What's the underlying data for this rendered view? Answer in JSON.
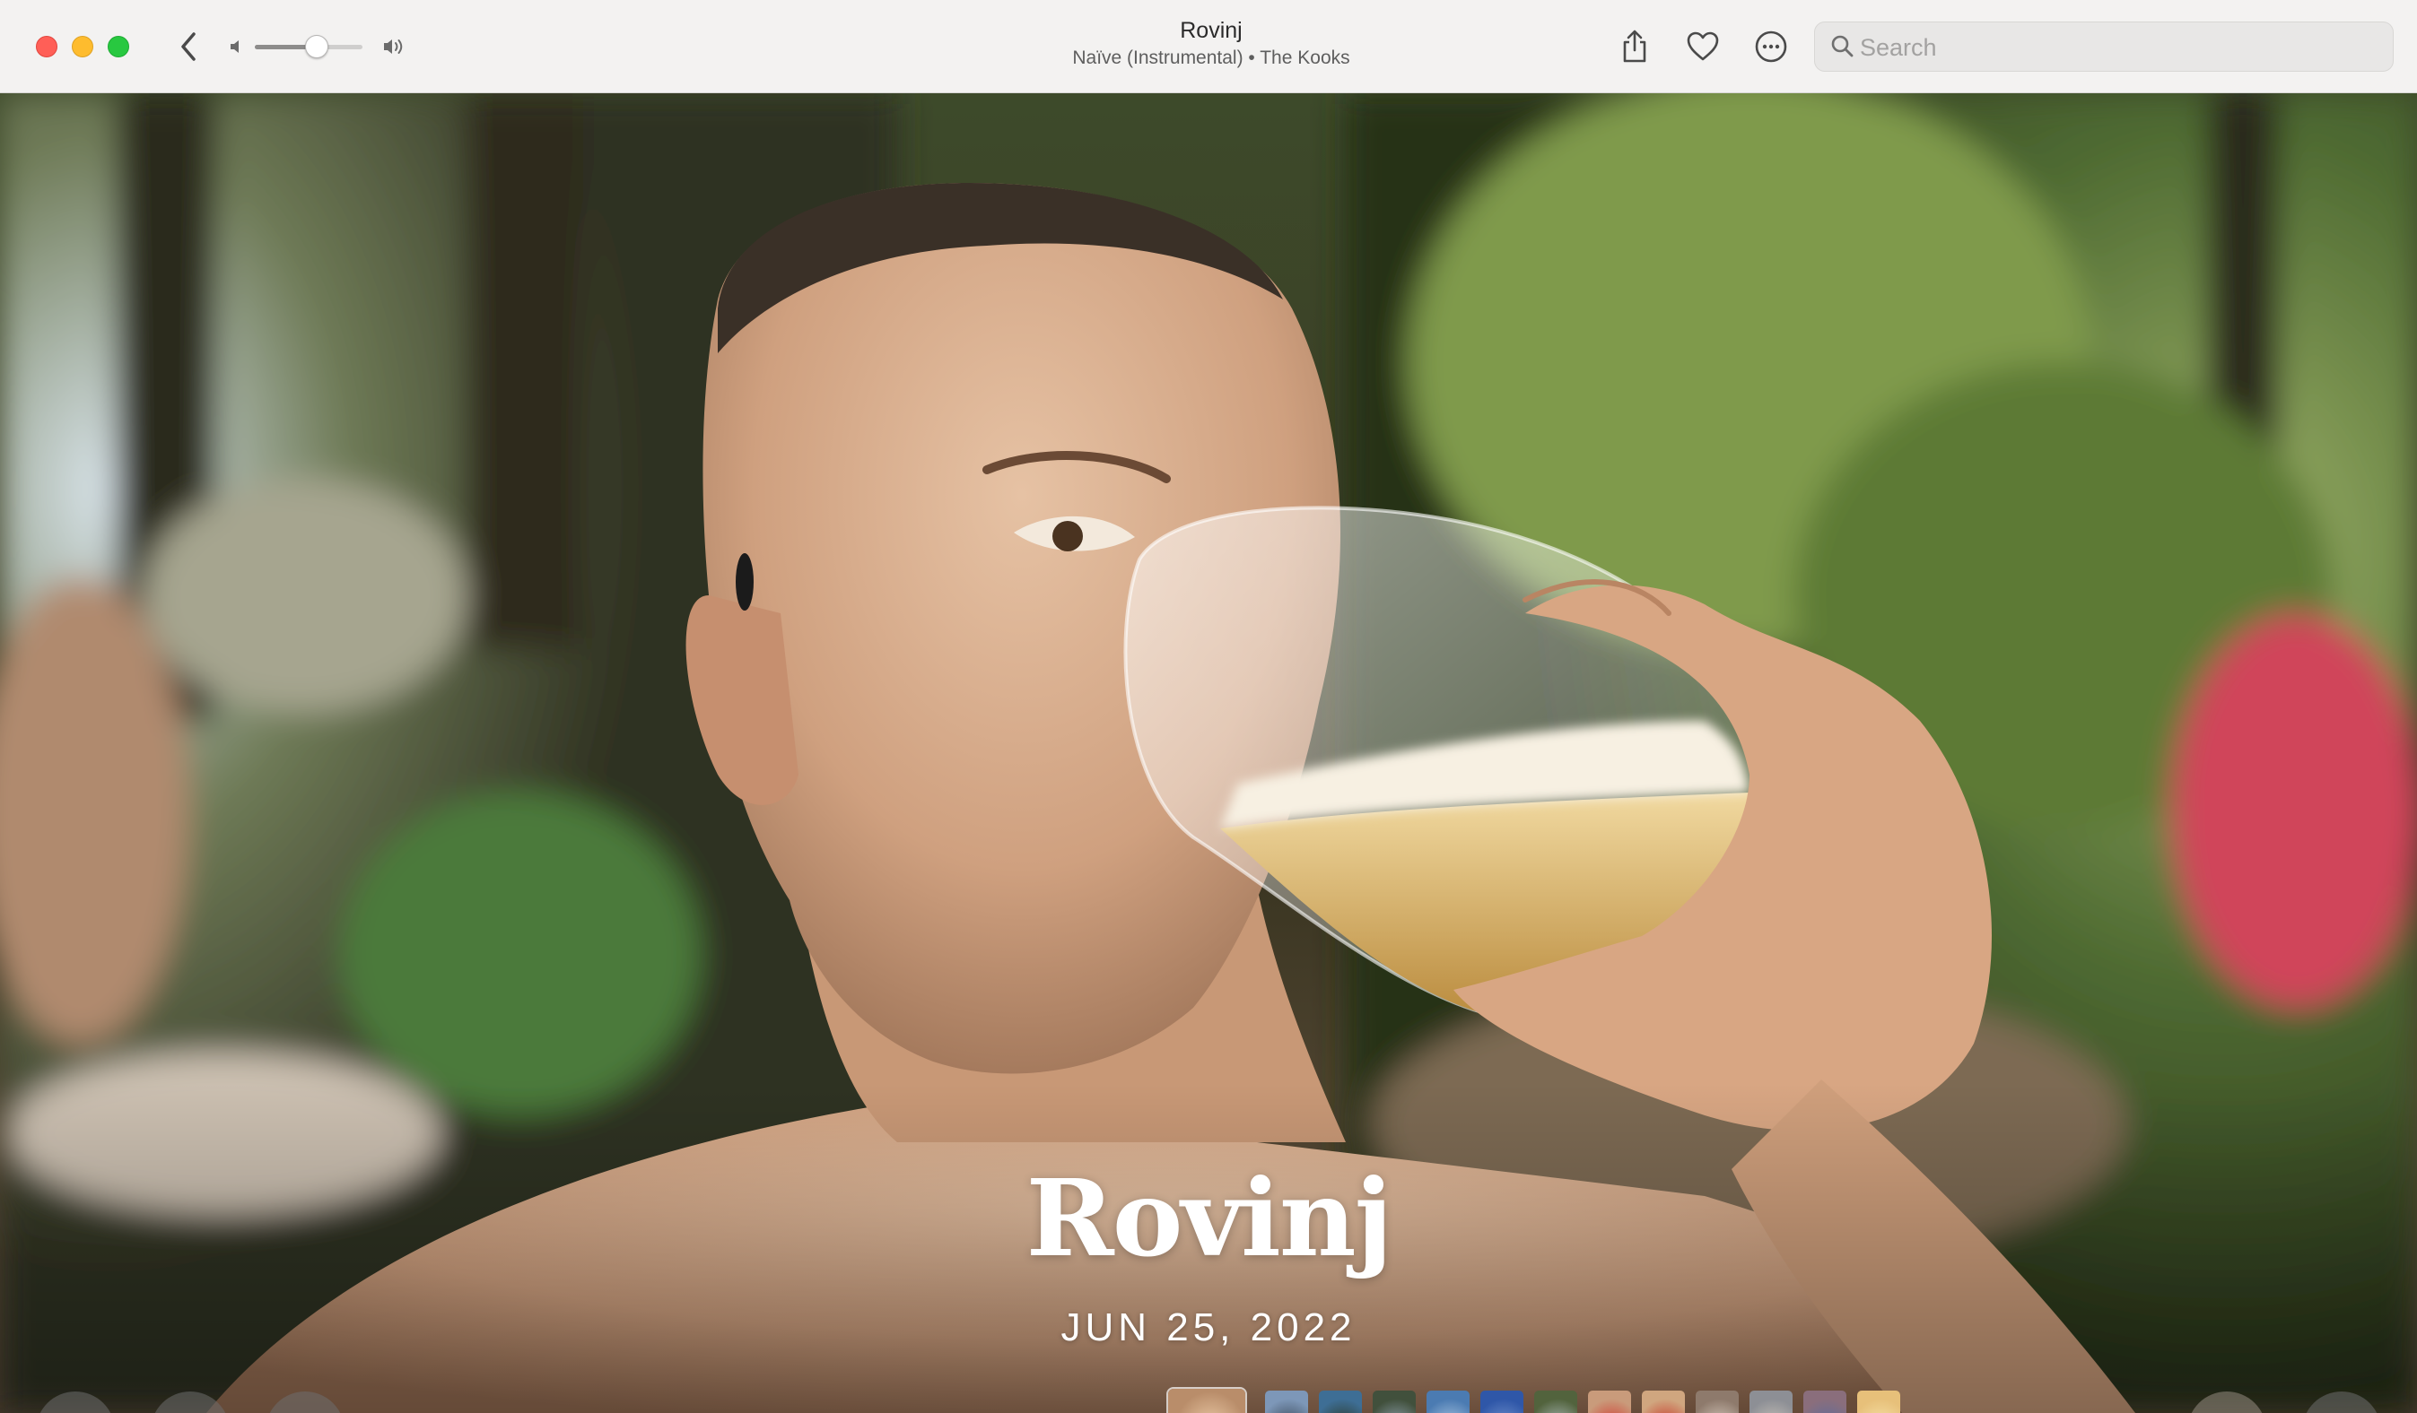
{
  "window": {
    "title": "Rovinj",
    "subtitle": "Naïve (Instrumental) • The Kooks"
  },
  "toolbar": {
    "back_icon": "chevron-left-icon",
    "volume_low_icon": "speaker-low-icon",
    "volume_high_icon": "speaker-high-icon",
    "volume_level": 0.6,
    "share_icon": "share-icon",
    "favorite_icon": "heart-icon",
    "more_icon": "ellipsis-circle-icon"
  },
  "search": {
    "placeholder": "Search",
    "value": ""
  },
  "memory": {
    "title": "Rovinj",
    "date": "JUN 25, 2022"
  },
  "controls": {
    "previous_icon": "skip-back-icon",
    "music_icon": "music-note-add-icon",
    "filters_icon": "look-filters-icon",
    "pause_icon": "pause-icon",
    "grid_icon": "grid-icon"
  },
  "thumbnails": [
    {
      "subject": "man drinking beer",
      "colors": [
        "#b98d6a",
        "#e9c7a3",
        "#3d4a2c"
      ]
    },
    {
      "subject": "rocky sea shore",
      "colors": [
        "#7d97b8",
        "#3b4a5a",
        "#c9d6e4"
      ]
    },
    {
      "subject": "sea under trees",
      "colors": [
        "#3e6e95",
        "#2c3a2a",
        "#9bb3c9"
      ]
    },
    {
      "subject": "pine tree on rocks",
      "colors": [
        "#41503c",
        "#8ea0ad",
        "#2c2c26"
      ]
    },
    {
      "subject": "coastline",
      "colors": [
        "#4b7bb2",
        "#a7c3df",
        "#5c5a50"
      ]
    },
    {
      "subject": "tree and blue sky",
      "colors": [
        "#2f57a8",
        "#6f8fcb",
        "#33502e"
      ]
    },
    {
      "subject": "forest",
      "colors": [
        "#52633d",
        "#a9b7b6",
        "#2e3727"
      ]
    },
    {
      "subject": "man with red sunglasses",
      "colors": [
        "#c99b7b",
        "#d13c32",
        "#5a6a4a"
      ]
    },
    {
      "subject": "man smiling with sunglasses",
      "colors": [
        "#d0a67f",
        "#c7382a",
        "#70884b"
      ]
    },
    {
      "subject": "street",
      "colors": [
        "#8e7a6c",
        "#d4c7bb",
        "#4c4544"
      ]
    },
    {
      "subject": "town street",
      "colors": [
        "#8d8f95",
        "#c5c0b8",
        "#4c4f57"
      ]
    },
    {
      "subject": "town square",
      "colors": [
        "#8a6e7c",
        "#5e6c9c",
        "#c7b6b8"
      ]
    },
    {
      "subject": "sunset by the sea",
      "colors": [
        "#e7c07a",
        "#f6e1a6",
        "#9a8d7d"
      ]
    }
  ],
  "colors": {
    "titlebar_bg": "#f3f2f1",
    "close": "#ff5f57",
    "minimize": "#febc2e",
    "zoom": "#28c840"
  }
}
